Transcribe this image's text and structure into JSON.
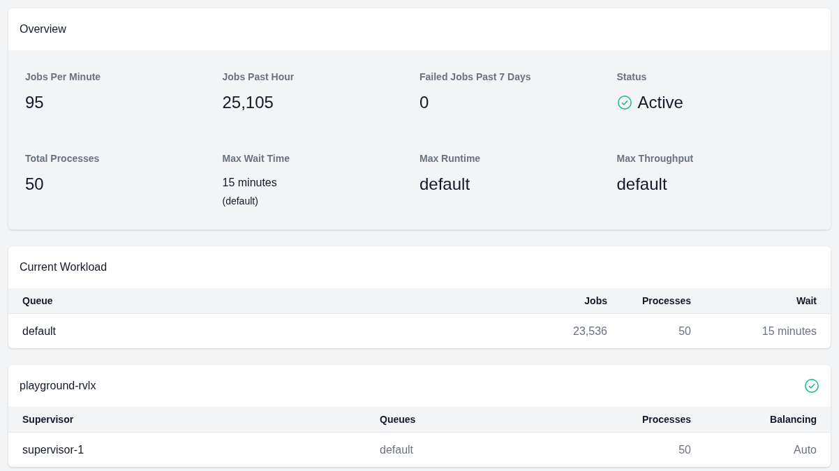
{
  "overview": {
    "title": "Overview",
    "stats": [
      {
        "kind": "big",
        "label": "Jobs Per Minute",
        "value": "95"
      },
      {
        "kind": "big",
        "label": "Jobs Past Hour",
        "value": "25,105"
      },
      {
        "kind": "big",
        "label": "Failed Jobs Past 7 Days",
        "value": "0"
      },
      {
        "kind": "status",
        "label": "Status",
        "value": "Active",
        "active": true
      },
      {
        "kind": "big",
        "label": "Total Processes",
        "value": "50"
      },
      {
        "kind": "detail",
        "label": "Max Wait Time",
        "value": "15 minutes",
        "note": "(default)"
      },
      {
        "kind": "big",
        "label": "Max Runtime",
        "value": "default"
      },
      {
        "kind": "big",
        "label": "Max Throughput",
        "value": "default"
      }
    ]
  },
  "workload": {
    "title": "Current Workload",
    "columns": [
      "Queue",
      "Jobs",
      "Processes",
      "Wait"
    ],
    "rows": [
      [
        "default",
        "23,536",
        "50",
        "15 minutes"
      ]
    ]
  },
  "supervisors": {
    "title": "playground-rvlx",
    "active": true,
    "columns": [
      "Supervisor",
      "Queues",
      "Processes",
      "Balancing"
    ],
    "rows": [
      [
        "supervisor-1",
        "default",
        "50",
        "Auto"
      ]
    ]
  }
}
